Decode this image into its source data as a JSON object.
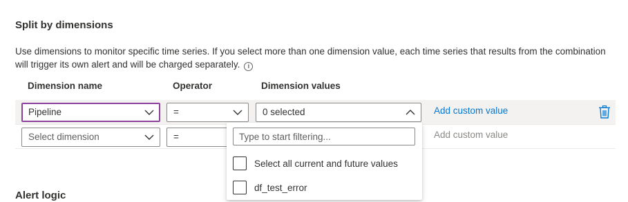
{
  "section": {
    "title": "Split by dimensions",
    "description": "Use dimensions to monitor specific time series. If you select more than one dimension value, each time series that results from the combination will trigger its own alert and will be charged separately.",
    "info_icon": "info-icon"
  },
  "columns": {
    "name": "Dimension name",
    "operator": "Operator",
    "values": "Dimension values"
  },
  "rows": [
    {
      "dimension": "Pipeline",
      "operator": "=",
      "values": "0 selected",
      "add_custom": "Add custom value",
      "delete_icon": "trash-icon"
    },
    {
      "dimension": "Select dimension",
      "operator": "=",
      "add_custom": "Add custom value"
    }
  ],
  "values_dropdown": {
    "filter_placeholder": "Type to start filtering...",
    "options": [
      {
        "label": "Select all current and future values",
        "checked": false
      },
      {
        "label": "df_test_error",
        "checked": false
      }
    ]
  },
  "next_section": {
    "title": "Alert logic"
  },
  "colors": {
    "accent_focus": "#8b3f9c",
    "link": "#0078d4",
    "row_highlight": "#f3f2f1"
  }
}
